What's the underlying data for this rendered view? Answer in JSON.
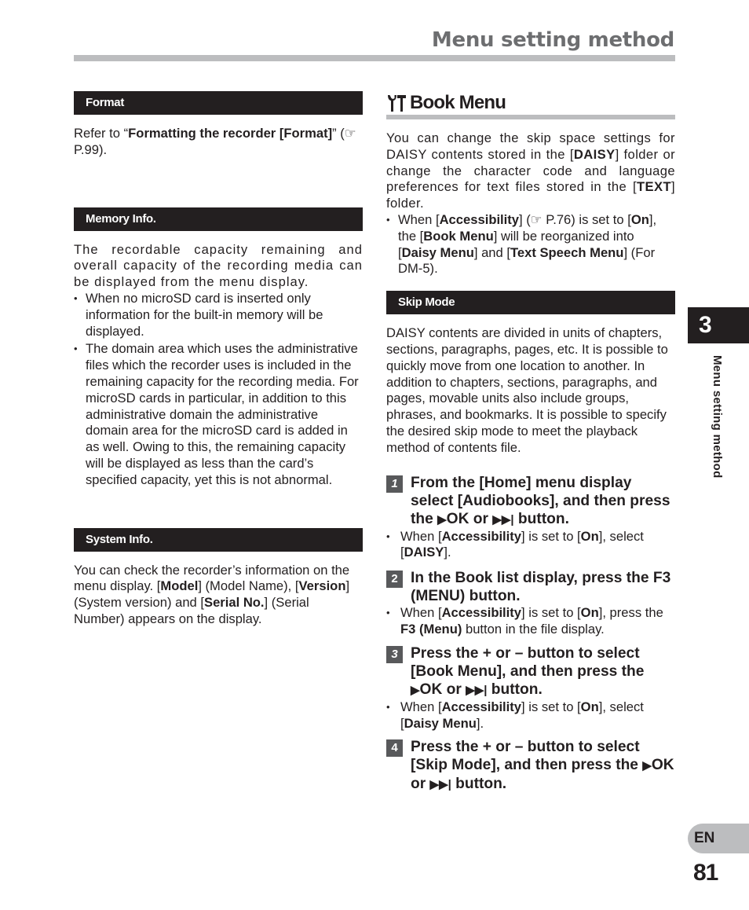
{
  "header": {
    "title": "Menu setting method"
  },
  "left_column": {
    "format": {
      "heading": "Format",
      "text_prefix": "Refer to “",
      "text_bold": "Formatting the recorder [Format]",
      "text_suffix": "” (☞ P.99)."
    },
    "memory_info": {
      "heading": "Memory Info.",
      "intro": "The recordable capacity remaining and overall capacity of the recording media can be displayed from the menu display.",
      "bullets": [
        "When no microSD card is inserted only information for the built-in memory will be displayed.",
        "The domain area which uses the administrative files which the recorder uses is included in the remaining capacity for the recording media. For microSD cards in particular, in addition to this administrative domain the administrative domain area for the microSD card is added in as well. Owing to this, the remaining capacity will be displayed as less than the card’s specified capacity, yet this is not abnormal."
      ]
    },
    "system_info": {
      "heading": "System Info.",
      "t1": "You can check the recorder’s information on the menu display. [",
      "b1": "Model",
      "t2": "] (Model Name), [",
      "b2": "Version",
      "t3": "] (System version) and [",
      "b3": "Serial No.",
      "t4": "] (Serial Number) appears on the display."
    }
  },
  "right_column": {
    "book_menu": {
      "icon": "tools-icon",
      "heading": "Book Menu",
      "intro_t1": "You can change the skip space settings for DAISY contents stored in the [",
      "intro_b1": "DAISY",
      "intro_t2": "] folder or change the character code and language preferences for text files stored in the [",
      "intro_b2": "TEXT",
      "intro_t3": "] folder.",
      "note": {
        "t1": "When [",
        "b1": "Accessibility",
        "t2": "] (☞ P.76) is set to [",
        "b2": "On",
        "t3": "], the [",
        "b3": "Book Menu",
        "t4": "] will be reorganized into [",
        "b4": "Daisy Menu",
        "t5": "] and [",
        "b5": "Text Speech Menu",
        "t6": "] (For DM-5)."
      }
    },
    "skip_mode": {
      "heading": "Skip Mode",
      "text": "DAISY contents are divided in units of chapters, sections, paragraphs, pages, etc. It is possible to quickly move from one location to another. In addition to chapters, sections, paragraphs, and pages, movable units also include groups, phrases, and bookmarks. It is possible to specify the desired skip mode to meet the playback method of contents file."
    },
    "steps": [
      {
        "num": "1",
        "text_a": "From the [Home] menu display select [Audiobooks], and then press the ",
        "glyph1": "▶",
        "text_b": "OK or ",
        "glyph2": "▶▶|",
        "text_c": " button.",
        "note": {
          "t1": "When [",
          "b1": "Accessibility",
          "t2": "] is set to [",
          "b2": "On",
          "t3": "], select [",
          "b3": "DAISY",
          "t4": "]."
        }
      },
      {
        "num": "2",
        "text_a": "In the Book list display, press the F3 (MENU) button.",
        "note": {
          "t1": "When [",
          "b1": "Accessibility",
          "t2": "] is set to [",
          "b2": "On",
          "t3": "], press the ",
          "b3": "F3 (Menu)",
          "t4": " button in the file display."
        }
      },
      {
        "num": "3",
        "text_a": "Press the + or – button to select [Book Menu], and then press the ",
        "glyph1": "▶",
        "text_b": "OK or ",
        "glyph2": "▶▶|",
        "text_c": " button.",
        "note": {
          "t1": "When [",
          "b1": "Accessibility",
          "t2": "] is set to [",
          "b2": "On",
          "t3": "], select [",
          "b3": "Daisy Menu",
          "t4": "]."
        }
      },
      {
        "num": "4",
        "text_a": "Press the + or – button to select [Skip Mode], and then press the ",
        "glyph1": "▶",
        "text_b": "OK or ",
        "glyph2": "▶▶|",
        "text_c": " button."
      }
    ]
  },
  "side": {
    "chapter_number": "3",
    "chapter_label": "Menu setting method",
    "language": "EN",
    "page_number": "81"
  },
  "colors": {
    "section_bar": "#231f20",
    "rule_gray": "#bcbdbf",
    "title_gray": "#6d6e70",
    "step_badge": "#58595b"
  }
}
